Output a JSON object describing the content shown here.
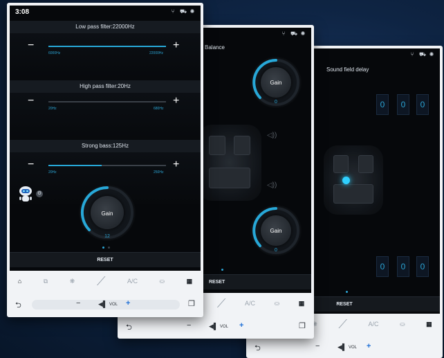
{
  "panel1": {
    "time": "3:08",
    "filters": [
      {
        "title": "Low pass filter:22000Hz",
        "min": "6000Hz",
        "max": "22000Hz",
        "level": 1.0
      },
      {
        "title": "High pass filter:20Hz",
        "min": "20Hz",
        "max": "680Hz",
        "level": 0.0
      },
      {
        "title": "Strong bass:125Hz",
        "min": "20Hz",
        "max": "250Hz",
        "level": 0.45
      }
    ],
    "minus": "−",
    "plus": "+",
    "gain": {
      "label": "Gain",
      "value": "12",
      "level": 0.6
    },
    "reset": "RESET",
    "nav": {
      "ac": "A/C"
    },
    "vol": {
      "label": "VOL"
    }
  },
  "panel2": {
    "title": "Balance",
    "gain_top": {
      "label": "Gain",
      "value": "0",
      "level": 0.5
    },
    "gain_bottom": {
      "label": "Gain",
      "value": "0",
      "level": 0.5
    },
    "reset": "RESET",
    "nav": {
      "ac": "A/C"
    },
    "vol": {
      "label": "VOL"
    }
  },
  "panel3": {
    "title": "Sound field delay",
    "top_values": [
      "0",
      "0",
      "0"
    ],
    "bottom_values": [
      "0",
      "0",
      "0"
    ],
    "reset": "RESET",
    "nav": {
      "ac": "A/C"
    },
    "vol": {
      "label": "VOL"
    }
  },
  "colors": {
    "accent": "#27a8d8",
    "screen": "#06080b",
    "frame": "#f1f3f6"
  }
}
